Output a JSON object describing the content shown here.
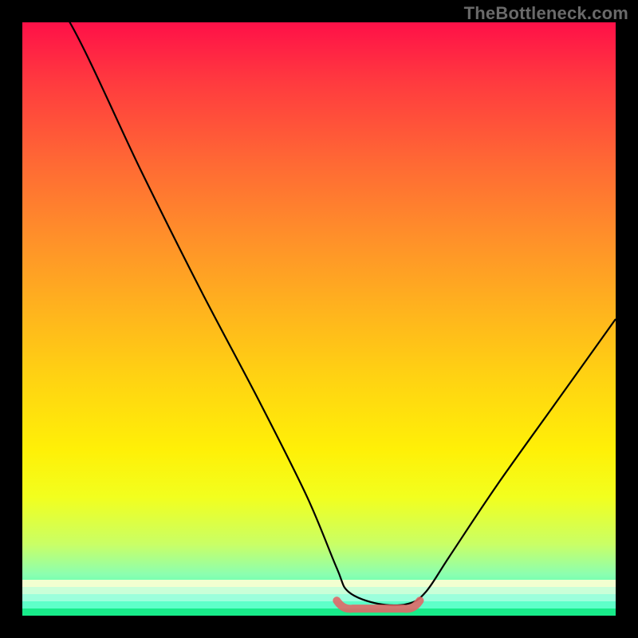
{
  "watermark": "TheBottleneck.com",
  "chart_data": {
    "type": "line",
    "title": "",
    "xlabel": "",
    "ylabel": "",
    "xlim": [
      0,
      100
    ],
    "ylim": [
      0,
      100
    ],
    "series": [
      {
        "name": "bottleneck-curve",
        "x": [
          0,
          8,
          20,
          30,
          40,
          48,
          53,
          55,
          60,
          65,
          68,
          72,
          80,
          90,
          100
        ],
        "values": [
          110,
          100,
          75,
          55,
          36,
          20,
          8,
          4,
          2,
          2,
          4,
          10,
          22,
          36,
          50
        ]
      }
    ],
    "plateau_marker": {
      "x_start": 53,
      "x_end": 67,
      "y": 2,
      "color": "#e06868"
    },
    "background_gradient": {
      "top": "#ff1048",
      "mid": "#ffd312",
      "bottom": "#13e987"
    },
    "bottom_bands": [
      {
        "color": "#f2ffd0",
        "y_from": 6.0,
        "y_to": 4.8
      },
      {
        "color": "#caffd8",
        "y_from": 4.8,
        "y_to": 3.6
      },
      {
        "color": "#9cffdc",
        "y_from": 3.6,
        "y_to": 2.4
      },
      {
        "color": "#5effc9",
        "y_from": 2.4,
        "y_to": 1.2
      },
      {
        "color": "#18eb8a",
        "y_from": 1.2,
        "y_to": 0.0
      }
    ]
  }
}
